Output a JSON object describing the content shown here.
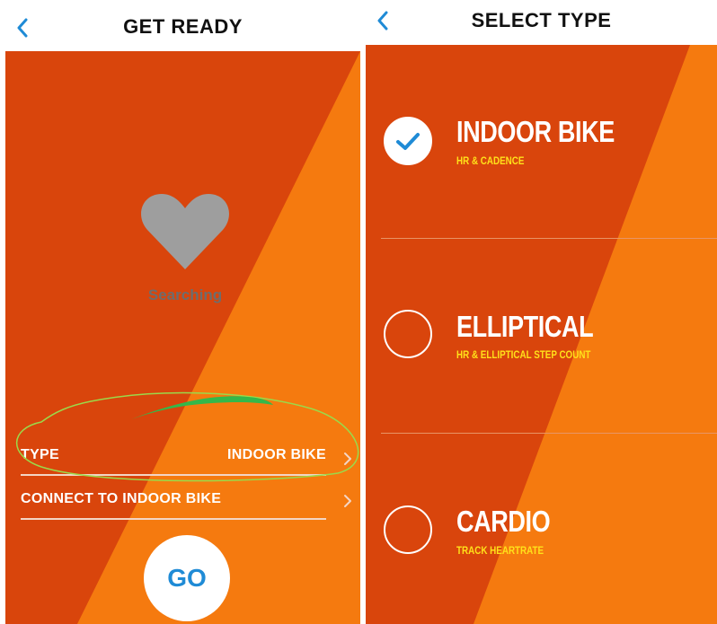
{
  "get_ready": {
    "title": "GET READY",
    "back_icon": "chevron-left-icon",
    "status_icon": "heart-icon",
    "status_text": "Searching",
    "type_row": {
      "label": "TYPE",
      "value": "INDOOR BIKE"
    },
    "connect_row": {
      "label": "CONNECT TO INDOOR BIKE"
    },
    "go_label": "GO"
  },
  "select_type": {
    "title": "SELECT TYPE",
    "back_icon": "chevron-left-icon",
    "options": [
      {
        "name": "INDOOR BIKE",
        "subtitle": "HR & CADENCE",
        "selected": true
      },
      {
        "name": "ELLIPTICAL",
        "subtitle": "HR & ELLIPTICAL STEP COUNT",
        "selected": false
      },
      {
        "name": "CARDIO",
        "subtitle": "TRACK HEARTRATE",
        "selected": false
      }
    ]
  },
  "colors": {
    "accent_blue": "#1f8bd6",
    "background_orange": "#d9450c",
    "stripe_orange": "#f57a0f",
    "subtitle_yellow": "#ffe11a",
    "heart_gray": "#9e9e9e",
    "annotation_green": "#9bd94a"
  }
}
